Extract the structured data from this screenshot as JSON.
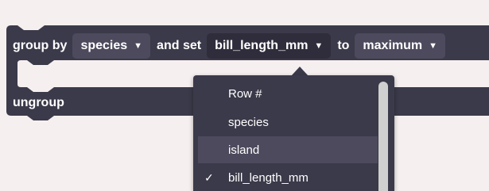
{
  "block": {
    "group_by_text": "group by",
    "group_field": "species",
    "and_set_text": "and set",
    "set_field": "bill_length_mm",
    "to_text": "to",
    "aggregate": "maximum",
    "ungroup_text": "ungroup"
  },
  "dropdown": {
    "items": [
      {
        "label": "Row #",
        "checked": false,
        "hovered": false
      },
      {
        "label": "species",
        "checked": false,
        "hovered": false
      },
      {
        "label": "island",
        "checked": false,
        "hovered": true
      },
      {
        "label": "bill_length_mm",
        "checked": true,
        "hovered": false
      }
    ],
    "check_mark": "✓"
  },
  "colors": {
    "background": "#f6eff0",
    "block": "#3b3a4a",
    "field": "#4c4a5c",
    "field_open": "#2f2d3b",
    "menu": "#3b3a4a",
    "menu_hover": "#4c4a5c",
    "scrollbar": "#d0d0d0"
  },
  "icons": {
    "dropdown_arrow": "caret-down-icon"
  }
}
